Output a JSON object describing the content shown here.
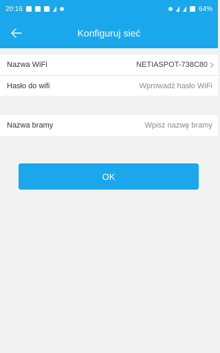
{
  "status_bar": {
    "time": "20:16",
    "battery": "64%"
  },
  "header": {
    "title": "Konfiguruj sieć",
    "back_icon": "arrow-left-icon"
  },
  "form": {
    "wifi_name_label": "Nazwa WiFi",
    "wifi_name_value": "NETIASPOT-738C80",
    "wifi_password_label": "Hasło do wifi",
    "wifi_password_placeholder": "Wprowadź hasło WiFi",
    "gateway_name_label": "Nazwa bramy",
    "gateway_name_placeholder": "Wpisz nazwę bramy"
  },
  "actions": {
    "ok_label": "OK"
  },
  "colors": {
    "accent": "#1aa7ec",
    "background": "#f2f2f2"
  }
}
